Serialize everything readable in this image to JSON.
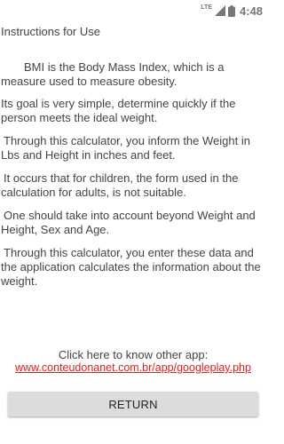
{
  "status_bar": {
    "network_type": "LTE",
    "time": "4:48"
  },
  "screen": {
    "title": "Instructions for Use",
    "paragraphs": [
      "BMI is the Body Mass Index, which is a measure used to measure obesity.",
      "Its goal is very simple, determine quickly if the person meets the ideal weight.",
      "Through this calculator, you inform the Weight in Lbs and Height in inches and feet.",
      "It occurs that for children, the form used in the calculation for adults, is not suitable.",
      "One should take into account beyond Weight and Height, Sex and Age.",
      "Through this calculator, you enter these data and the application calculates the information about the weight."
    ],
    "link_caption": "Click here to know other app:",
    "link_text": "www.conteudonanet.com.br/app/googleplay.php",
    "link_color": "#e02020",
    "return_label": "RETURN"
  }
}
